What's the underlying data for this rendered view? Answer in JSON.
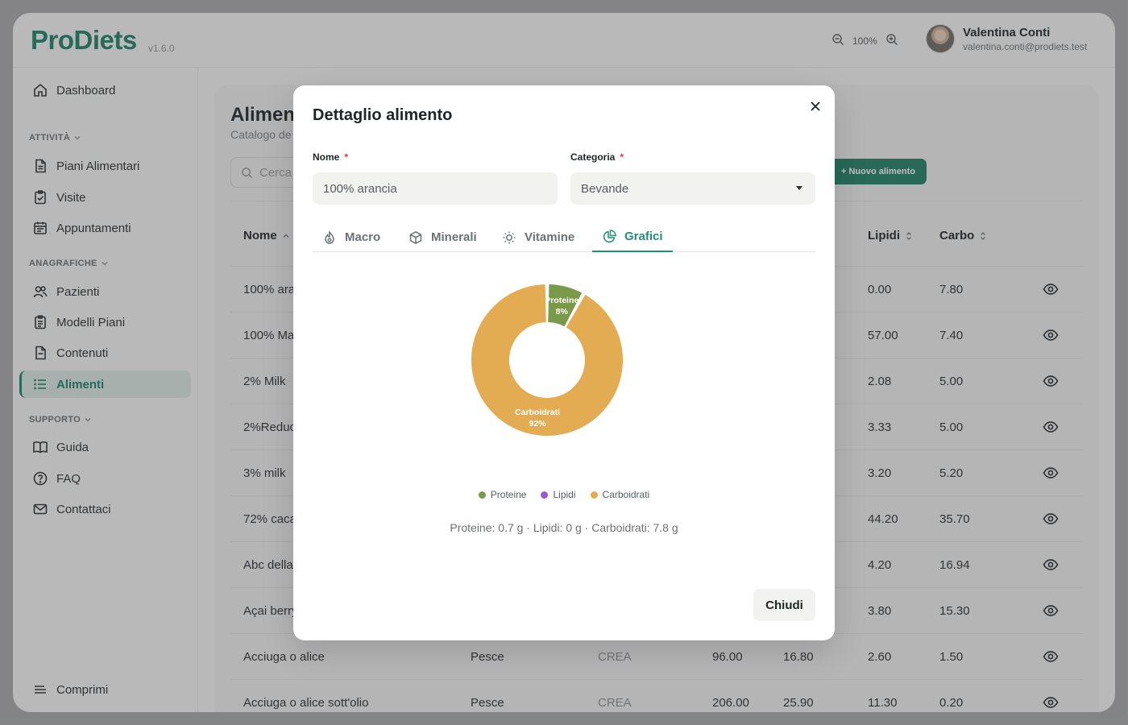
{
  "app": {
    "logo": "ProDiets",
    "version": "v1.6.0",
    "zoom": "100%"
  },
  "user": {
    "name": "Valentina Conti",
    "email": "valentina.conti@prodiets.test"
  },
  "sidebar": {
    "dashboard": "Dashboard",
    "sections": [
      "ATTIVITÀ",
      "ANAGRAFICHE",
      "SUPPORTO"
    ],
    "items": [
      "Piani Alimentari",
      "Visite",
      "Appuntamenti",
      "Pazienti",
      "Modelli Piani",
      "Contenuti",
      "Alimenti",
      "Guida",
      "FAQ",
      "Contattaci"
    ],
    "collapse": "Comprimi"
  },
  "page": {
    "title": "Alimen",
    "subtitle": "Catalogo de",
    "search_placeholder": "Cerca",
    "new_button": "+ Nuovo alimento",
    "headers": [
      "Nome",
      "Lipidi",
      "Carbo"
    ],
    "rows": [
      {
        "name": "100% arar",
        "cat": "",
        "src": "",
        "kcal": "",
        "prot": "",
        "lip": "0.00",
        "carbo": "7.80"
      },
      {
        "name": "100% Mar",
        "cat": "",
        "src": "",
        "kcal": "",
        "prot": "",
        "lip": "57.00",
        "carbo": "7.40"
      },
      {
        "name": "2% Milk",
        "cat": "",
        "src": "",
        "kcal": "",
        "prot": "",
        "lip": "2.08",
        "carbo": "5.00"
      },
      {
        "name": "2%Reduc",
        "cat": "",
        "src": "",
        "kcal": "",
        "prot": "",
        "lip": "3.33",
        "carbo": "5.00"
      },
      {
        "name": "3% milk",
        "cat": "",
        "src": "",
        "kcal": "",
        "prot": "",
        "lip": "3.20",
        "carbo": "5.20"
      },
      {
        "name": "72% cacao",
        "cat": "",
        "src": "",
        "kcal": "",
        "prot": "",
        "lip": "44.20",
        "carbo": "35.70"
      },
      {
        "name": "Abc della",
        "cat": "",
        "src": "",
        "kcal": "",
        "prot": "",
        "lip": "4.20",
        "carbo": "16.94"
      },
      {
        "name": "Açai berry",
        "cat": "",
        "src": "",
        "kcal": "",
        "prot": "",
        "lip": "3.80",
        "carbo": "15.30"
      },
      {
        "name": "Acciuga o alice",
        "cat": "Pesce",
        "src": "CREA",
        "kcal": "96.00",
        "prot": "16.80",
        "lip": "2.60",
        "carbo": "1.50"
      },
      {
        "name": "Acciuga o alice sott'olio",
        "cat": "Pesce",
        "src": "CREA",
        "kcal": "206.00",
        "prot": "25.90",
        "lip": "11.30",
        "carbo": "0.20"
      }
    ]
  },
  "modal": {
    "title": "Dettaglio alimento",
    "nome_label": "Nome",
    "nome_value": "100% arancia",
    "categoria_label": "Categoria",
    "categoria_value": "Bevande",
    "required_mark": "*",
    "tabs": [
      "Macro",
      "Minerali",
      "Vitamine",
      "Grafici"
    ],
    "active_tab": "Grafici",
    "summary": "Proteine: 0.7 g · Lipidi: 0 g · Carboidrati: 7.8 g",
    "close_button": "Chiudi"
  },
  "chart_data": {
    "type": "pie",
    "categories": [
      "Proteine",
      "Lipidi",
      "Carboidrati"
    ],
    "values": [
      8,
      0,
      92
    ],
    "labels": [
      "Proteine 8%",
      "",
      "Carboidrati 92%"
    ],
    "colors": [
      "#7a9a4a",
      "#9b59d0",
      "#e3ac52"
    ],
    "legend": "bottom"
  }
}
